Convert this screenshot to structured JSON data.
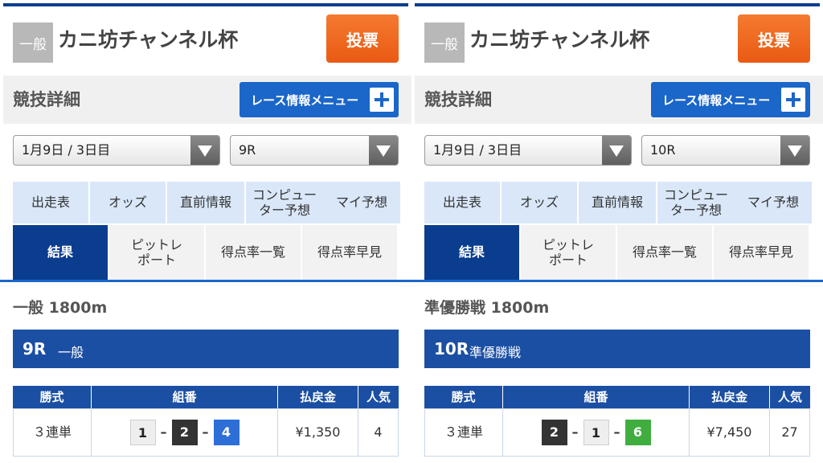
{
  "panels": [
    {
      "grade_badge": "一般",
      "race_title": "カニ坊チャンネル杯",
      "vote_label": "投票",
      "section_title": "競技詳細",
      "menu_label": "レース情報メニュー",
      "date_select": "1月9日 / 3日目",
      "race_select": "9R",
      "tabs_row1": [
        "出走表",
        "オッズ",
        "直前情報",
        "コンピュー\nター予想",
        "マイ予想"
      ],
      "tabs_row2": [
        "結果",
        "ピットレ\nポート",
        "得点率一覧",
        "得点率早見"
      ],
      "grade_distance": "一般 1800m",
      "race_no": "9R",
      "race_grade": "一般",
      "headers": [
        "勝式",
        "組番",
        "払戻金",
        "人気"
      ],
      "row": {
        "type": "３連単",
        "combo": [
          {
            "num": "1",
            "bg": "#eeeeee",
            "fg": "#222222"
          },
          {
            "num": "2",
            "bg": "#333333",
            "fg": "#ffffff"
          },
          {
            "num": "4",
            "bg": "#2d6fd6",
            "fg": "#ffffff"
          }
        ],
        "payout": "¥1,350",
        "popularity": "4"
      }
    },
    {
      "grade_badge": "一般",
      "race_title": "カニ坊チャンネル杯",
      "vote_label": "投票",
      "section_title": "競技詳細",
      "menu_label": "レース情報メニュー",
      "date_select": "1月9日 / 3日目",
      "race_select": "10R",
      "tabs_row1": [
        "出走表",
        "オッズ",
        "直前情報",
        "コンピュー\nター予想",
        "マイ予想"
      ],
      "tabs_row2": [
        "結果",
        "ピットレ\nポート",
        "得点率一覧",
        "得点率早見"
      ],
      "grade_distance": "準優勝戦 1800m",
      "race_no": "10R",
      "race_grade": "準優勝戦",
      "headers": [
        "勝式",
        "組番",
        "払戻金",
        "人気"
      ],
      "row": {
        "type": "３連単",
        "combo": [
          {
            "num": "2",
            "bg": "#333333",
            "fg": "#ffffff"
          },
          {
            "num": "1",
            "bg": "#eeeeee",
            "fg": "#222222"
          },
          {
            "num": "6",
            "bg": "#3fae3f",
            "fg": "#ffffff"
          }
        ],
        "payout": "¥7,450",
        "popularity": "27"
      }
    }
  ],
  "colors": {
    "brand_navy": "#0b3d8e",
    "accent_blue": "#1b66c9",
    "vote_orange": "#ea5a14",
    "tab_light": "#d9e7f9"
  }
}
